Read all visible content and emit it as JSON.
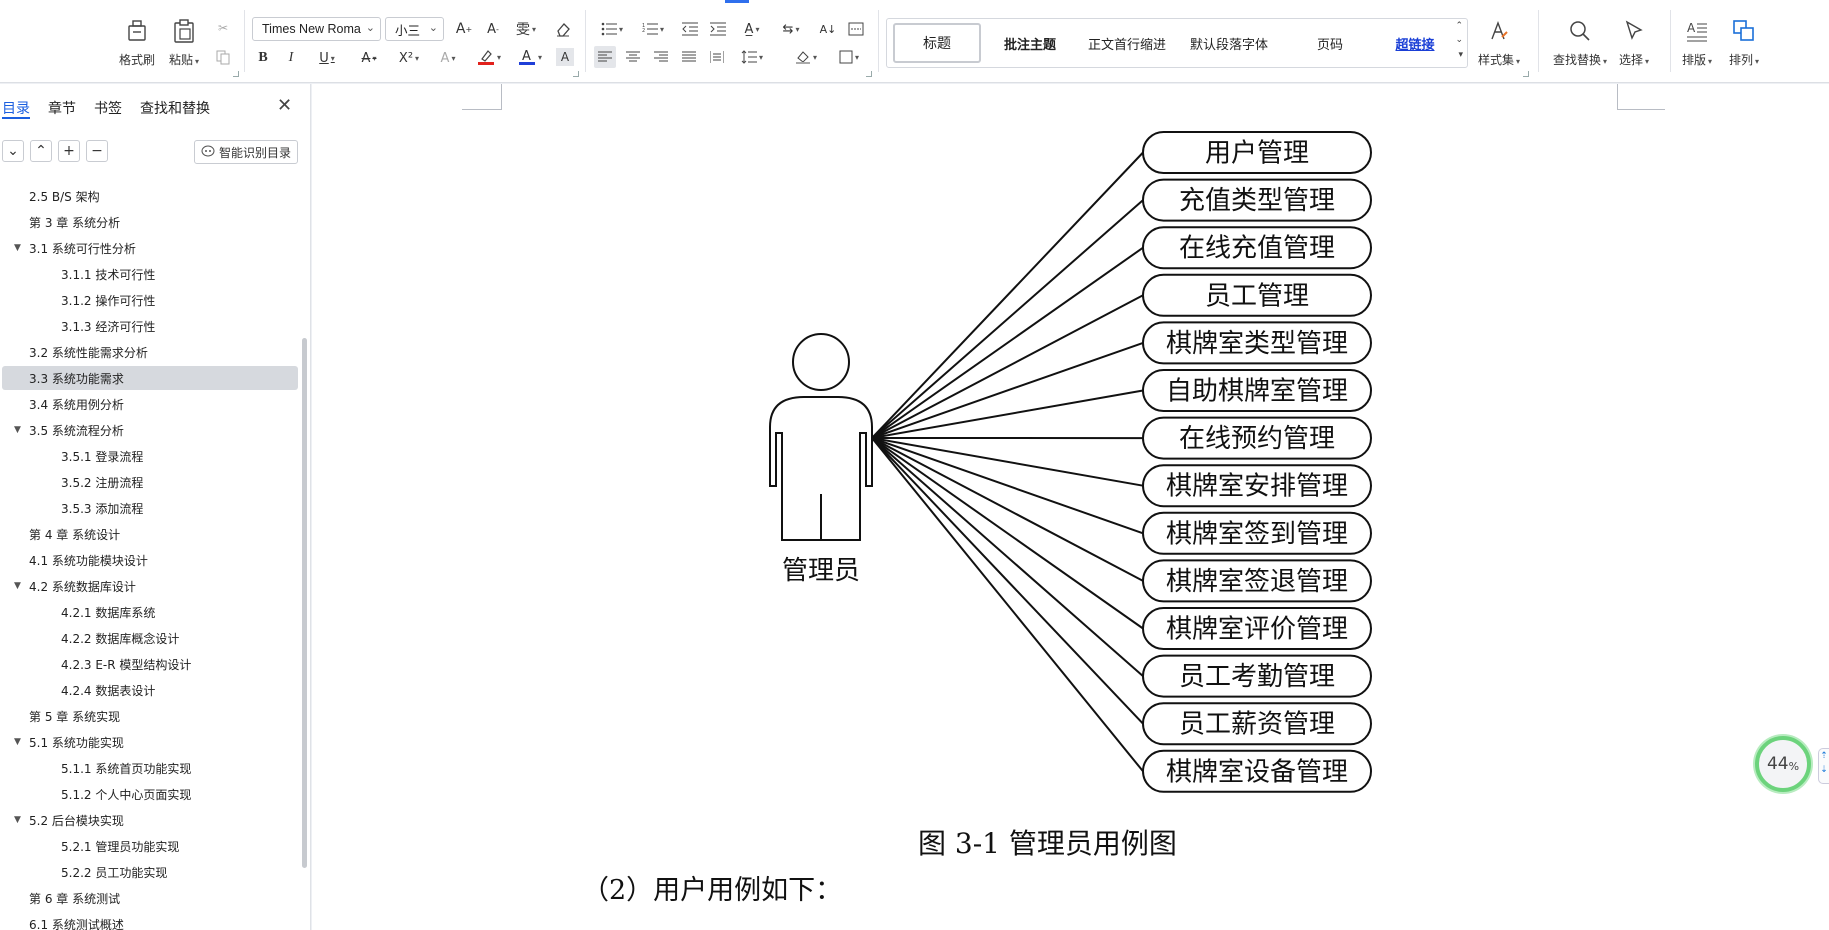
{
  "ribbon": {
    "format_painter": "格式刷",
    "paste": "粘贴",
    "font_name": "Times New Roma",
    "font_size": "小三",
    "styles": {
      "title": "标题",
      "comment_theme": "批注主题",
      "first_indent": "正文首行缩进",
      "default_para_font": "默认段落字体",
      "page_number": "页码",
      "hyperlink": "超链接"
    },
    "style_set": "样式集",
    "find_replace": "查找替换",
    "select": "选择",
    "layout": "排版",
    "arrange": "排列"
  },
  "sidebar": {
    "tabs": [
      "目录",
      "章节",
      "书签",
      "查找和替换"
    ],
    "smart_toc": "智能识别目录",
    "items": [
      {
        "label": "2.5 B/S 架构",
        "level": 1,
        "expand": false,
        "selected": false
      },
      {
        "label": "第 3 章  系统分析",
        "level": 1,
        "expand": false,
        "selected": false
      },
      {
        "label": "3.1  系统可行性分析",
        "level": 1,
        "expand": true,
        "selected": false
      },
      {
        "label": "3.1.1  技术可行性",
        "level": 2,
        "expand": false,
        "selected": false
      },
      {
        "label": "3.1.2  操作可行性",
        "level": 2,
        "expand": false,
        "selected": false
      },
      {
        "label": "3.1.3  经济可行性",
        "level": 2,
        "expand": false,
        "selected": false
      },
      {
        "label": "3.2 系统性能需求分析",
        "level": 1,
        "expand": false,
        "selected": false
      },
      {
        "label": "3.3 系统功能需求",
        "level": 1,
        "expand": false,
        "selected": true
      },
      {
        "label": "3.4  系统用例分析",
        "level": 1,
        "expand": false,
        "selected": false
      },
      {
        "label": "3.5  系统流程分析",
        "level": 1,
        "expand": true,
        "selected": false
      },
      {
        "label": "3.5.1  登录流程",
        "level": 2,
        "expand": false,
        "selected": false
      },
      {
        "label": "3.5.2  注册流程",
        "level": 2,
        "expand": false,
        "selected": false
      },
      {
        "label": "3.5.3  添加流程",
        "level": 2,
        "expand": false,
        "selected": false
      },
      {
        "label": "第 4 章  系统设计",
        "level": 1,
        "expand": false,
        "selected": false
      },
      {
        "label": "4.1 系统功能模块设计",
        "level": 1,
        "expand": false,
        "selected": false
      },
      {
        "label": "4.2  系统数据库设计",
        "level": 1,
        "expand": true,
        "selected": false
      },
      {
        "label": "4.2.1  数据库系统",
        "level": 2,
        "expand": false,
        "selected": false
      },
      {
        "label": "4.2.2  数据库概念设计",
        "level": 2,
        "expand": false,
        "selected": false
      },
      {
        "label": "4.2.3 E-R 模型结构设计",
        "level": 2,
        "expand": false,
        "selected": false
      },
      {
        "label": "4.2.4 数据表设计",
        "level": 2,
        "expand": false,
        "selected": false
      },
      {
        "label": "第 5 章  系统实现",
        "level": 1,
        "expand": false,
        "selected": false
      },
      {
        "label": "5.1 系统功能实现",
        "level": 1,
        "expand": true,
        "selected": false
      },
      {
        "label": "5.1.1 系统首页功能实现",
        "level": 2,
        "expand": false,
        "selected": false
      },
      {
        "label": "5.1.2 个人中心页面实现",
        "level": 2,
        "expand": false,
        "selected": false
      },
      {
        "label": "5.2 后台模块实现",
        "level": 1,
        "expand": true,
        "selected": false
      },
      {
        "label": "5.2.1 管理员功能实现",
        "level": 2,
        "expand": false,
        "selected": false
      },
      {
        "label": "5.2.2 员工功能实现",
        "level": 2,
        "expand": false,
        "selected": false
      },
      {
        "label": "第 6 章    系统测试",
        "level": 1,
        "expand": false,
        "selected": false
      },
      {
        "label": "6.1  系统测试概述",
        "level": 1,
        "expand": false,
        "selected": false
      }
    ]
  },
  "document": {
    "actor": "管理员",
    "use_cases": [
      "用户管理",
      "充值类型管理",
      "在线充值管理",
      "员工管理",
      "棋牌室类型管理",
      "自助棋牌室管理",
      "在线预约管理",
      "棋牌室安排管理",
      "棋牌室签到管理",
      "棋牌室签退管理",
      "棋牌室评价管理",
      "员工考勤管理",
      "员工薪资管理",
      "棋牌室设备管理"
    ],
    "caption": "图 3-1  管理员用例图",
    "next_paragraph": "（2）用户用例如下："
  },
  "zoom": {
    "value": "44",
    "unit": "%"
  },
  "colors": {
    "accent": "#1b5fe0",
    "zoom_ring": "#6cd37c",
    "selected_row": "#d6d9de"
  }
}
